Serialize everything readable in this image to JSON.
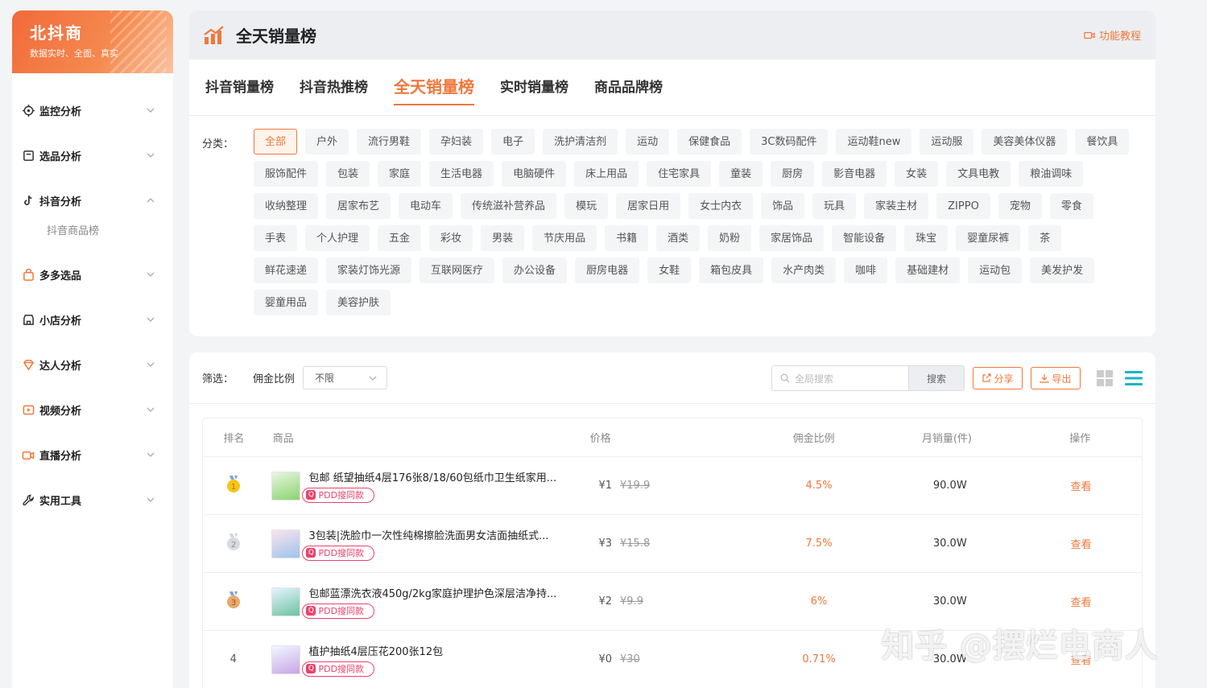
{
  "sidebar": {
    "brand": "北抖商",
    "slogan": "数据实时、全面、真实",
    "items": [
      {
        "label": "监控分析"
      },
      {
        "label": "选品分析"
      },
      {
        "label": "抖音分析"
      },
      {
        "label": "多多选品"
      },
      {
        "label": "小店分析"
      },
      {
        "label": "达人分析"
      },
      {
        "label": "视频分析"
      },
      {
        "label": "直播分析"
      },
      {
        "label": "实用工具"
      }
    ],
    "sub_item": "抖音商品榜"
  },
  "header": {
    "title": "全天销量榜",
    "tutorial": "功能教程"
  },
  "tabs": [
    "抖音销量榜",
    "抖音热推榜",
    "全天销量榜",
    "实时销量榜",
    "商品品牌榜"
  ],
  "categories": {
    "label": "分类：",
    "items": [
      "全部",
      "户外",
      "流行男鞋",
      "孕妇装",
      "电子",
      "洗护清洁剂",
      "运动",
      "保健食品",
      "3C数码配件",
      "运动鞋new",
      "运动服",
      "美容美体仪器",
      "餐饮具",
      "服饰配件",
      "包装",
      "家庭",
      "生活电器",
      "电脑硬件",
      "床上用品",
      "住宅家具",
      "童装",
      "厨房",
      "影音电器",
      "女装",
      "文具电教",
      "粮油调味",
      "收纳整理",
      "居家布艺",
      "电动车",
      "传统滋补营养品",
      "模玩",
      "居家日用",
      "女士内衣",
      "饰品",
      "玩具",
      "家装主材",
      "ZIPPO",
      "宠物",
      "零食",
      "手表",
      "个人护理",
      "五金",
      "彩妆",
      "男装",
      "节庆用品",
      "书籍",
      "酒类",
      "奶粉",
      "家居饰品",
      "智能设备",
      "珠宝",
      "婴童尿裤",
      "茶",
      "鲜花速递",
      "家装灯饰光源",
      "互联网医疗",
      "办公设备",
      "厨房电器",
      "女鞋",
      "箱包皮具",
      "水产肉类",
      "咖啡",
      "基础建材",
      "运动包",
      "美发护发",
      "婴童用品",
      "美容护肤"
    ]
  },
  "filter": {
    "label": "筛选：",
    "commission_label": "佣金比例",
    "commission_value": "不限",
    "search_placeholder": "全局搜索",
    "search_button": "搜索",
    "share": "分享",
    "export": "导出"
  },
  "table": {
    "headers": [
      "排名",
      "商品",
      "价格",
      "佣金比例",
      "月销量(件)",
      "操作"
    ],
    "rows": [
      {
        "rank": "1",
        "name": "包邮 纸望抽纸4层176张8/18/60包纸巾卫生纸家用...",
        "tag": "PDD搜同款",
        "price": "¥1",
        "old_price": "¥19.9",
        "commission": "4.5%",
        "sales": "90.0W",
        "action": "查看"
      },
      {
        "rank": "2",
        "name": "3包装|洗脸巾一次性纯棉擦脸洗面男女洁面抽纸式...",
        "tag": "PDD搜同款",
        "price": "¥3",
        "old_price": "¥15.8",
        "commission": "7.5%",
        "sales": "30.0W",
        "action": "查看"
      },
      {
        "rank": "3",
        "name": "包邮蓝漂洗衣液450g/2kg家庭护理护色深层洁净持...",
        "tag": "PDD搜同款",
        "price": "¥2",
        "old_price": "¥9.9",
        "commission": "6%",
        "sales": "30.0W",
        "action": "查看"
      },
      {
        "rank": "4",
        "name": "植护抽纸4层压花200张12包",
        "tag": "PDD搜同款",
        "price": "¥0",
        "old_price": "¥30",
        "commission": "0.71%",
        "sales": "30.0W",
        "action": "查看"
      }
    ]
  },
  "watermark": "知乎 @摆烂电商人",
  "colors": {
    "accent": "#f0783c",
    "pdd": "#e8436e"
  }
}
